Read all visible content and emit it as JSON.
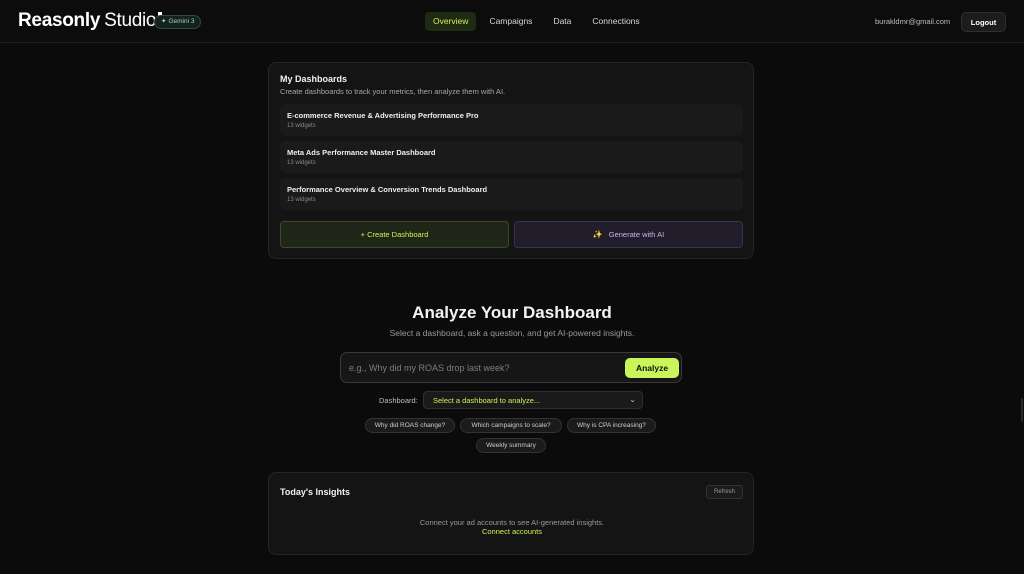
{
  "header": {
    "brand_bold": "Reasonly",
    "brand_light": "Studio",
    "badge_icon": "sparkle",
    "badge_label": "Gemini 3",
    "nav": [
      {
        "label": "Overview",
        "active": true
      },
      {
        "label": "Campaigns",
        "active": false
      },
      {
        "label": "Data",
        "active": false
      },
      {
        "label": "Connections",
        "active": false
      }
    ],
    "user_email": "burakldmr@gmail.com",
    "logout_label": "Logout"
  },
  "dashboards": {
    "title": "My Dashboards",
    "subtitle": "Create dashboards to track your metrics, then analyze them with AI.",
    "items": [
      {
        "name": "E-commerce Revenue & Advertising Performance Pro",
        "meta": "13 widgets"
      },
      {
        "name": "Meta Ads Performance Master Dashboard",
        "meta": "13 widgets"
      },
      {
        "name": "Performance Overview & Conversion Trends Dashboard",
        "meta": "13 widgets"
      }
    ],
    "create_label": "+ Create Dashboard",
    "generate_label": "Generate with AI",
    "generate_icon": "sparkles"
  },
  "analyze": {
    "title": "Analyze Your Dashboard",
    "subtitle": "Select a dashboard, ask a question, and get AI-powered insights.",
    "input_value": "",
    "input_placeholder": "e.g., Why did my ROAS drop last week?",
    "button_label": "Analyze",
    "dashboard_label": "Dashboard:",
    "dashboard_selected": "Select a dashboard to analyze...",
    "suggestions": [
      "Why did ROAS change?",
      "Which campaigns to scale?",
      "Why is CPA increasing?",
      "Weekly summary"
    ]
  },
  "insights": {
    "title": "Today's Insights",
    "refresh_label": "Refresh",
    "empty_text": "Connect your ad accounts to see AI-generated insights.",
    "link_label": "Connect accounts"
  },
  "colors": {
    "accent": "#c9f45a",
    "background": "#0b0b0b",
    "card": "#141414",
    "ai_purple": "#c8b6f0"
  }
}
